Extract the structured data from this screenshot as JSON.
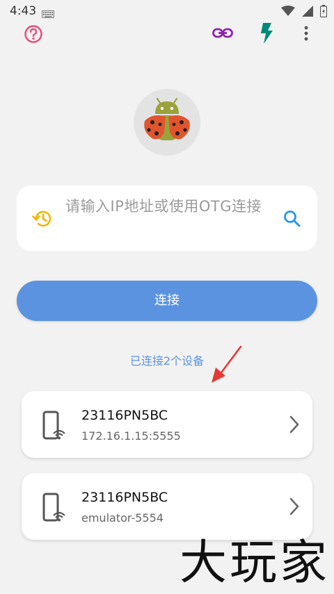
{
  "status_bar": {
    "time": "4:43"
  },
  "toolbar": {
    "help_icon": "help-circle-icon",
    "link_icon": "link-icon",
    "flash_icon": "flash-icon",
    "more_icon": "more-vertical-icon"
  },
  "search": {
    "placeholder": "请输入IP地址或使用OTG连接"
  },
  "connect_button": {
    "label": "连接"
  },
  "devices_header": {
    "text": "已连接2个设备"
  },
  "devices": [
    {
      "name": "23116PN5BC",
      "address": "172.16.1.15:5555"
    },
    {
      "name": "23116PN5BC",
      "address": "emulator-5554"
    }
  ],
  "watermark": {
    "text": "大玩家"
  },
  "colors": {
    "accent": "#5b93e0",
    "help": "#e84c7d",
    "link": "#8e24aa",
    "flash": "#00897b",
    "history": "#f4b400",
    "search": "#2196f3",
    "arrow": "#e53935"
  }
}
